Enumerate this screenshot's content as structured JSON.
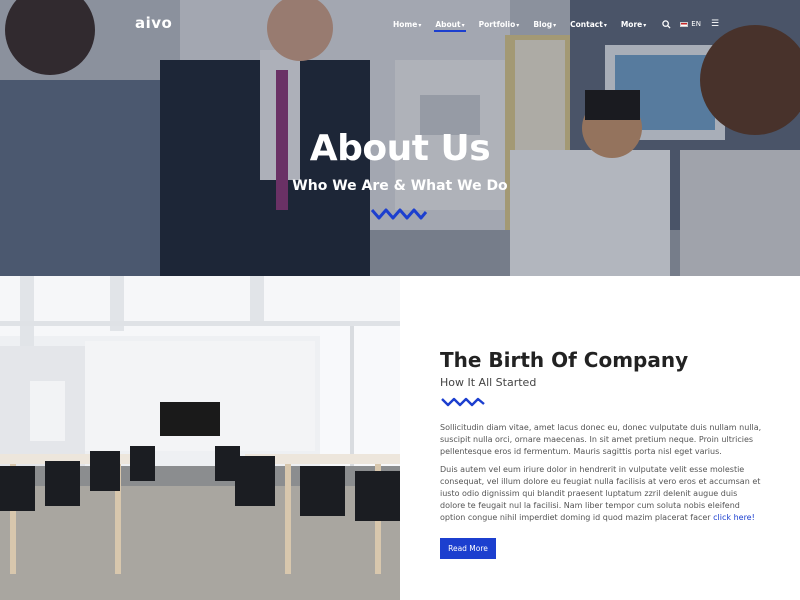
{
  "header": {
    "logo": "aivo",
    "nav": [
      {
        "label": "Home",
        "active": false
      },
      {
        "label": "About",
        "active": true
      },
      {
        "label": "Portfolio",
        "active": false
      },
      {
        "label": "Blog",
        "active": false
      },
      {
        "label": "Contact",
        "active": false
      },
      {
        "label": "More",
        "active": false
      }
    ],
    "search_icon": "search-icon",
    "language": "EN",
    "menu_icon": "menu-icon"
  },
  "hero": {
    "title": "About Us",
    "subtitle": "Who We Are & What We Do"
  },
  "section": {
    "title": "The Birth Of Company",
    "subtitle": "How It All Started",
    "paragraph1": "Sollicitudin diam vitae, amet lacus donec eu, donec vulputate duis nullam nulla, suscipit nulla orci, ornare maecenas. In sit amet pretium neque. Proin ultricies pellentesque eros id fermentum. Mauris sagittis porta nisl eget varius.",
    "paragraph2": "Duis autem vel eum iriure dolor in hendrerit in vulputate velit esse molestie consequat, vel illum dolore eu feugiat nulla facilisis at vero eros et accumsan et iusto odio dignissim qui blandit praesent luptatum zzril delenit augue duis dolore te feugait nul la facilisi. Nam liber tempor cum soluta nobis eleifend option congue nihil imperdiet doming id quod mazim placerat facer",
    "link": "click here!",
    "button": "Read More"
  },
  "colors": {
    "accent": "#1c3fcf",
    "heading": "#222222",
    "text": "#555555"
  }
}
